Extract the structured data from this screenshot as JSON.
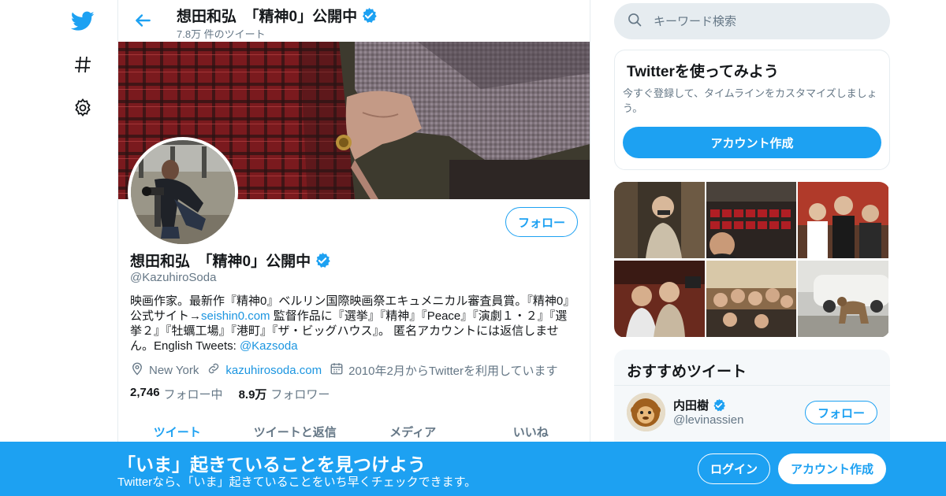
{
  "nav": {
    "icons": [
      "twitter-logo-icon",
      "hashtag-icon",
      "gear-icon"
    ]
  },
  "header": {
    "name": "想田和弘　「精神0」公開中",
    "tweet_count": "7.8万 件のツイート"
  },
  "profile": {
    "name": "想田和弘　「精神0」公開中",
    "handle": "@KazuhiroSoda",
    "follow_label": "フォロー",
    "bio": {
      "part1": "映画作家。最新作『精神0』ベルリン国際映画祭エキュメニカル審査員賞。『精神0』公式サイト→",
      "link1": "seishin0.com",
      "part2": " 監督作品に『選挙』『精神』『Peace』『演劇１・２』『選挙２』『牡蠣工場』『港町』『ザ・ビッグハウス』。 匿名アカウントには返信しません。English Tweets: ",
      "link2": "@Kazsoda"
    },
    "location": "New York",
    "website": "kazuhirosoda.com",
    "joined": "2010年2月からTwitterを利用しています",
    "following_count": "2,746",
    "following_label": "フォロー中",
    "followers_count": "8.9万",
    "followers_label": "フォロワー"
  },
  "tabs": [
    {
      "label": "ツイート",
      "active": true
    },
    {
      "label": "ツイートと返信",
      "active": false
    },
    {
      "label": "メディア",
      "active": false
    },
    {
      "label": "いいね",
      "active": false
    }
  ],
  "search": {
    "placeholder": "キーワード検索"
  },
  "signup_card": {
    "title": "Twitterを使ってみよう",
    "description": "今すぐ登録して、タイムラインをカスタマイズしましょう。",
    "button": "アカウント作成"
  },
  "recommended": {
    "title": "おすすめツイート",
    "user": {
      "name": "内田樹",
      "handle": "@levinassien",
      "follow_label": "フォロー"
    }
  },
  "bottom_bar": {
    "headline": "「いま」起きていることを見つけよう",
    "subtext": "Twitterなら、「いま」起きていることをいち早くチェックできます。",
    "login_label": "ログイン",
    "signup_label": "アカウント作成"
  },
  "colors": {
    "accent": "#1da1f2",
    "link": "#1b95e0",
    "muted": "#657786",
    "text": "#14171a"
  }
}
